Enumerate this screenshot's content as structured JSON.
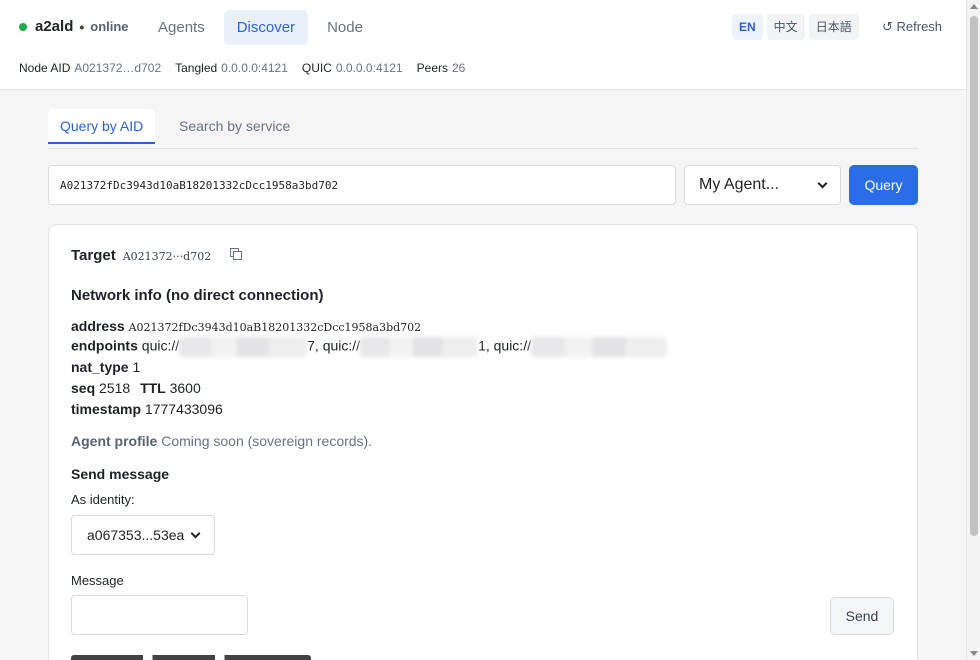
{
  "header": {
    "brand": "a2ald",
    "separator": "•",
    "status": "online",
    "status_color": "#22a84a",
    "nav": [
      {
        "label": "Agents",
        "active": false
      },
      {
        "label": "Discover",
        "active": true
      },
      {
        "label": "Node",
        "active": false
      }
    ],
    "languages": [
      {
        "label": "EN",
        "active": true
      },
      {
        "label": "中文",
        "active": false
      },
      {
        "label": "日本語",
        "active": false
      }
    ],
    "refresh_label": "↺ Refresh",
    "node_info": [
      {
        "label": "Node AID",
        "value": "A021372…d702"
      },
      {
        "label": "Tangled",
        "value": "0.0.0.0:4121"
      },
      {
        "label": "QUIC",
        "value": "0.0.0.0:4121"
      },
      {
        "label": "Peers",
        "value": "26"
      }
    ]
  },
  "subtabs": [
    {
      "label": "Query by AID",
      "active": true
    },
    {
      "label": "Search by service",
      "active": false
    }
  ],
  "query": {
    "aid_value": "A021372fDc3943d10aB18201332cDcc1958a3bd702",
    "agent_select": "My Agent...",
    "query_label": "Query"
  },
  "result": {
    "target_label": "Target",
    "target_value": "A021372···d702",
    "network_title": "Network info (no direct connection)",
    "address_key": "address",
    "address_value": "A021372fDc3943d10aB18201332cDcc1958a3bd702",
    "endpoints_key": "endpoints",
    "endpoints_prefix": "quic://",
    "endpoints_mid1": "7, quic://",
    "endpoints_mid2": "1, quic://",
    "nat_type_key": "nat_type",
    "nat_type_value": "1",
    "seq_key": "seq",
    "seq_value": "2518",
    "ttl_key": "TTL",
    "ttl_value": "3600",
    "timestamp_key": "timestamp",
    "timestamp_value": "1777433096",
    "profile_label": "Agent profile",
    "profile_text": "Coming soon (sovereign records).",
    "send_title": "Send message",
    "identity_label": "As identity:",
    "identity_value": "a067353...53ea",
    "message_label": "Message",
    "send_label": "Send"
  },
  "colors": {
    "accent": "#2b6de6",
    "background": "#f5f5f6"
  }
}
